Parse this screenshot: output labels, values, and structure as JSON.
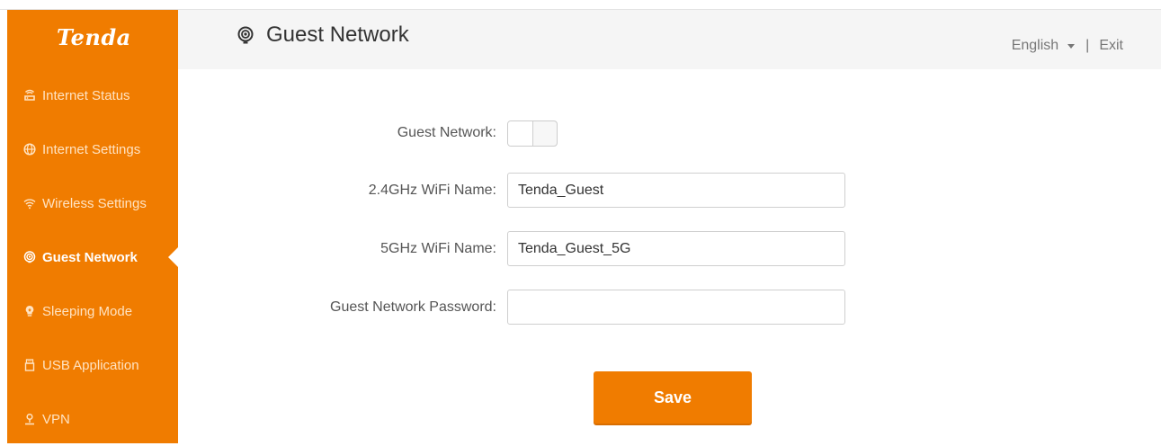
{
  "brand": {
    "logo_text": "Tenda"
  },
  "colors": {
    "accent": "#f07c00",
    "header_bg": "#f5f5f5",
    "label": "#555555"
  },
  "sidebar": {
    "items": [
      {
        "label": "Internet Status",
        "icon": "router-icon",
        "active": false
      },
      {
        "label": "Internet Settings",
        "icon": "globe-icon",
        "active": false
      },
      {
        "label": "Wireless Settings",
        "icon": "wifi-icon",
        "active": false
      },
      {
        "label": "Guest Network",
        "icon": "guest-wifi-icon",
        "active": true
      },
      {
        "label": "Sleeping Mode",
        "icon": "bulb-icon",
        "active": false
      },
      {
        "label": "USB Application",
        "icon": "usb-icon",
        "active": false
      },
      {
        "label": "VPN",
        "icon": "vpn-icon",
        "active": false
      }
    ]
  },
  "header": {
    "title": "Guest Network",
    "title_icon": "guest-wifi-icon",
    "language": "English",
    "separator": "|",
    "exit_label": "Exit"
  },
  "form": {
    "guest_network_label": "Guest Network:",
    "guest_network_enabled": false,
    "wifi24_label": "2.4GHz WiFi Name:",
    "wifi24_value": "Tenda_Guest",
    "wifi5_label": "5GHz WiFi Name:",
    "wifi5_value": "Tenda_Guest_5G",
    "password_label": "Guest Network Password:",
    "password_value": "",
    "save_label": "Save"
  }
}
